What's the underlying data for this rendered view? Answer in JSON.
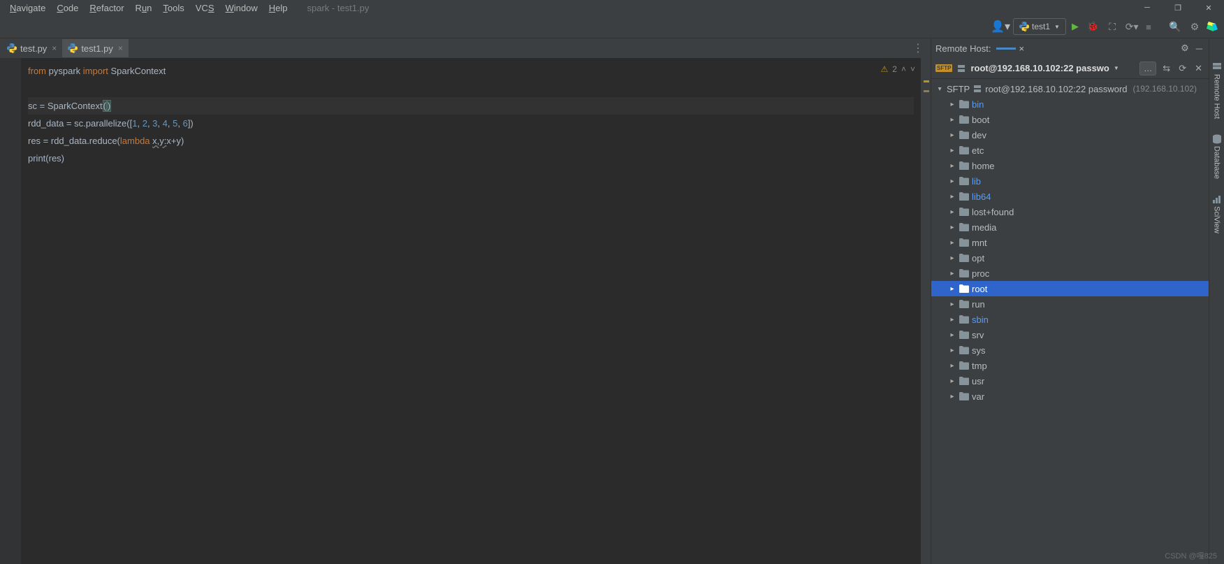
{
  "menubar": {
    "items": [
      {
        "label": "Navigate",
        "ul": "N"
      },
      {
        "label": "Code",
        "ul": "C"
      },
      {
        "label": "Refactor",
        "ul": "R"
      },
      {
        "label": "Run",
        "ul": "u"
      },
      {
        "label": "Tools",
        "ul": "T"
      },
      {
        "label": "VCS",
        "ul": "S"
      },
      {
        "label": "Window",
        "ul": "W"
      },
      {
        "label": "Help",
        "ul": "H"
      }
    ],
    "title": "spark - test1.py"
  },
  "toolbar": {
    "run_config": "test1"
  },
  "tabs": [
    {
      "label": "test.py",
      "active": false
    },
    {
      "label": "test1.py",
      "active": true
    }
  ],
  "editor": {
    "warnings": "2",
    "code": {
      "line1_from": "from ",
      "line1_module": "pyspark ",
      "line1_import": "import ",
      "line1_name": "SparkContext",
      "line3_a": "sc = SparkContext",
      "line3_p1": "(",
      "line3_p2": ")",
      "line4_a": "rdd_data = sc.parallelize([",
      "line4_n1": "1",
      "line4_s1": ", ",
      "line4_n2": "2",
      "line4_s2": ", ",
      "line4_n3": "3",
      "line4_s3": ", ",
      "line4_n4": "4",
      "line4_s4": ", ",
      "line4_n5": "5",
      "line4_s5": ", ",
      "line4_n6": "6",
      "line4_b": "])",
      "line5_a": "res = rdd_data.reduce(",
      "line5_lambda": "lambda ",
      "line5_args": "x,y:",
      "line5_body": "x+y)",
      "line6": "print(res)"
    }
  },
  "remote": {
    "panel_title": "Remote Host:",
    "host_short": "root@192.168.10.102:22 passwo",
    "root_label": "root@192.168.10.102:22 password",
    "root_extra": "(192.168.10.102)",
    "items": [
      {
        "label": "bin",
        "link": true
      },
      {
        "label": "boot",
        "link": false
      },
      {
        "label": "dev",
        "link": false
      },
      {
        "label": "etc",
        "link": false
      },
      {
        "label": "home",
        "link": false
      },
      {
        "label": "lib",
        "link": true
      },
      {
        "label": "lib64",
        "link": true
      },
      {
        "label": "lost+found",
        "link": false
      },
      {
        "label": "media",
        "link": false
      },
      {
        "label": "mnt",
        "link": false
      },
      {
        "label": "opt",
        "link": false
      },
      {
        "label": "proc",
        "link": false
      },
      {
        "label": "root",
        "link": false,
        "selected": true
      },
      {
        "label": "run",
        "link": false
      },
      {
        "label": "sbin",
        "link": true
      },
      {
        "label": "srv",
        "link": false
      },
      {
        "label": "sys",
        "link": false
      },
      {
        "label": "tmp",
        "link": false
      },
      {
        "label": "usr",
        "link": false
      },
      {
        "label": "var",
        "link": false
      }
    ]
  },
  "sidebar": {
    "items": [
      "Remote Host",
      "Database",
      "SciView"
    ]
  },
  "watermark": "CSDN @嘎825"
}
